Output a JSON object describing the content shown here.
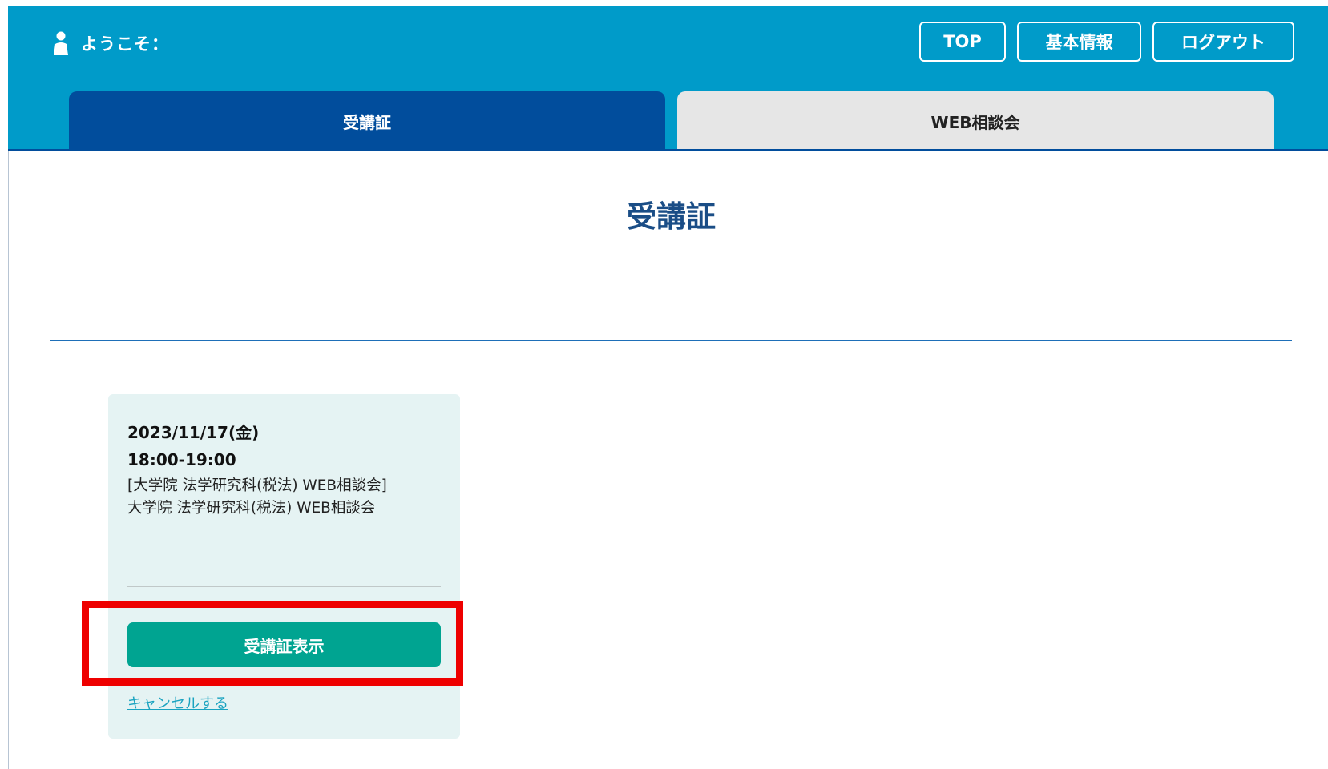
{
  "header": {
    "welcome_text": "ようこそ：",
    "buttons": {
      "top": "TOP",
      "basic_info": "基本情報",
      "logout": "ログアウト"
    },
    "tabs": [
      {
        "label": "受講証",
        "active": true
      },
      {
        "label": "WEB相談会",
        "active": false
      }
    ]
  },
  "main": {
    "title": "受講証",
    "card": {
      "date": "2023/11/17(金)",
      "time": "18:00-19:00",
      "line1": "[大学院 法学研究科(税法) WEB相談会]",
      "line2": "大学院 法学研究科(税法) WEB相談会",
      "show_button": "受講証表示",
      "cancel_link": "キャンセルする"
    }
  },
  "colors": {
    "header_bg": "#009bc9",
    "tab_active": "#014d9c",
    "tab_inactive": "#e6e6e6",
    "card_bg": "#e5f3f3",
    "primary_button": "#00a491",
    "highlight": "#ee0000"
  },
  "icons": {
    "welcome": "user-icon"
  }
}
